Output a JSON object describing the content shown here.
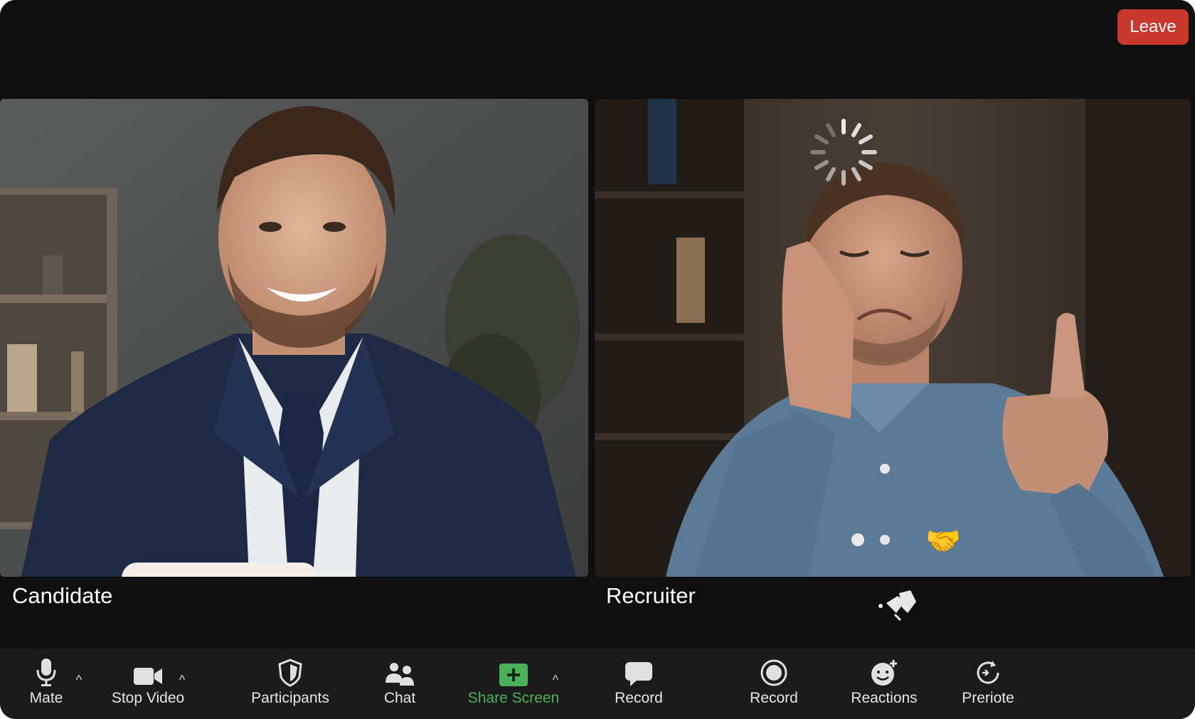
{
  "header": {
    "leave_label": "Leave"
  },
  "participants": [
    {
      "name": "Candidate"
    },
    {
      "name": "Recruiter"
    }
  ],
  "candidate_reaction": {
    "emojis": [
      "💰",
      "📈",
      "🤝"
    ]
  },
  "recruiter_reaction": {
    "emoji": "🤝"
  },
  "toolbar": {
    "items": [
      {
        "label": "Mate"
      },
      {
        "label": "Stop Video"
      },
      {
        "label": "Participants"
      },
      {
        "label": "Chat"
      },
      {
        "label": "Share Screen"
      },
      {
        "label": "Record"
      },
      {
        "label": "Record"
      },
      {
        "label": "Reactions"
      },
      {
        "label": "Preriote"
      }
    ],
    "caret": "^"
  },
  "colors": {
    "leave": "#c9382d",
    "share_screen": "#4cb05a",
    "background": "#0f0f10",
    "toolbar": "#1b1b1c"
  }
}
